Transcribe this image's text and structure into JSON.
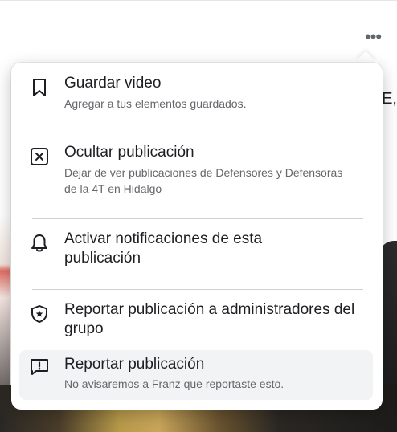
{
  "post": {
    "more_label": "•••",
    "text_fragment": "E,"
  },
  "menu": {
    "items": [
      {
        "title": "Guardar video",
        "subtitle": "Agregar a tus elementos guardados.",
        "icon": "bookmark-icon"
      },
      {
        "title": "Ocultar publicación",
        "subtitle": "Dejar de ver publicaciones de Defensores y Defensoras de la 4T en Hidalgo",
        "icon": "hide-box-icon"
      },
      {
        "title": "Activar notificaciones de esta publicación",
        "subtitle": "",
        "icon": "bell-icon"
      },
      {
        "title": "Reportar publicación a administradores del grupo",
        "subtitle": "",
        "icon": "admin-shield-icon"
      },
      {
        "title": "Reportar publicación",
        "subtitle": "No avisaremos a Franz que reportaste esto.",
        "icon": "report-flag-icon"
      }
    ]
  }
}
